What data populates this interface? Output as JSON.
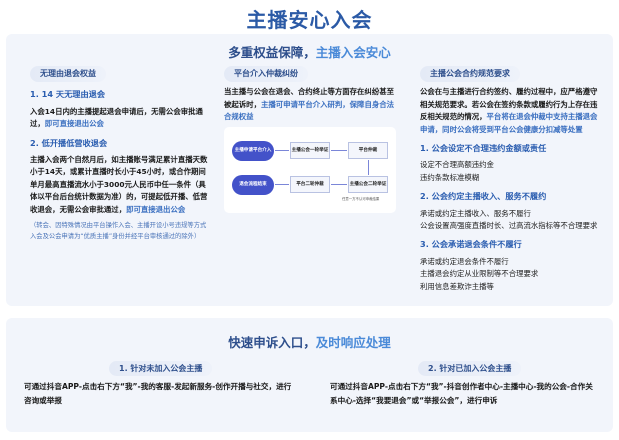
{
  "title": "主播安心入会",
  "top": {
    "heading_a": "多重权益保障，",
    "heading_b": "主播入会安心",
    "left": {
      "pill": "无理由退会权益",
      "s1": "1. 14 天无理由退会",
      "s1_text": "入会14日内的主播提起退会申请后，无需公会审批通过，",
      "s1_link": "即可直接退出公会",
      "s2": "2. 低开播低营收退会",
      "s2_text": "主播入会两个自然月后，如主播账号满足累计直播天数小于14天，或累计直播时长小于45小时，或合作期间单月最高直播流水小于3000元人民币中任一条件（具体以平台后台统计数据为准）的，可提起低开播、低营收退会，无需公会审批通过，",
      "s2_link": "即可直接退出公会",
      "note": "（转会、因特殊情况由平台操作入会、主播开设小号违规等方式入会及公会申请为“优质主播”身份并经平台审核通过的除外）"
    },
    "mid": {
      "pill": "平台介入仲裁纠纷",
      "text": "当主播与公会在退会、合约终止等方面存在纠纷甚至被起诉时，",
      "link": "主播可申请平台介入研判，保障自身合法合规权益",
      "flow": {
        "n1": "主播申请平台介入",
        "n2": "主播公会一轮举证",
        "n3": "平台仲裁",
        "n4": "主播公会二轮举证",
        "n5": "平台二轮仲裁",
        "n6": "退会流程结束",
        "note": "任意一方不认可申裁结果"
      }
    },
    "right": {
      "pill": "主播公会合约规范要求",
      "text": "公会在与主播进行合约签约、履约过程中，应严格遵守相关规范要求。若公会在签约条款或履约行为上存在违反相关规范的情况，",
      "link": "平台将在退会仲裁中支持主播退会申请，同时公会将受到平台公会健康分扣减等处置",
      "items": [
        {
          "title": "1. 公会设定不合理违约金额或责任",
          "lines": [
            "设定不合理高额违约金",
            "违约条款标准模糊"
          ]
        },
        {
          "title": "2. 公会约定主播收入、服务不履约",
          "lines": [
            "承诺或约定主播收入、服务不履行",
            "公会设置高强度直播时长、过高流水指标等不合理要求"
          ]
        },
        {
          "title": "3. 公会承诺退会条件不履行",
          "lines": [
            "承诺或约定退会条件不履行",
            "主播退会约定从业限制等不合理要求",
            "利用信息差欺诈主播等"
          ]
        }
      ]
    }
  },
  "bottom": {
    "heading_a": "快速申诉入口，",
    "heading_b": "及时响应处理",
    "c1": {
      "pill": "1. 针对未加入公会主播",
      "text": "可通过抖音APP-点击右下方“我”-我的客服-发起新服务-创作开播与社交，进行咨询或举报"
    },
    "c2": {
      "pill": "2. 针对已加入公会主播",
      "text": "可通过抖音APP-点击右下方“我”-抖音创作者中心-主播中心-我的公会-合作关系中心-选择“我要退会”或“举报公会”，进行申诉"
    }
  },
  "colors": {
    "accent": "#2b5aa6",
    "node": "#4352c9"
  }
}
